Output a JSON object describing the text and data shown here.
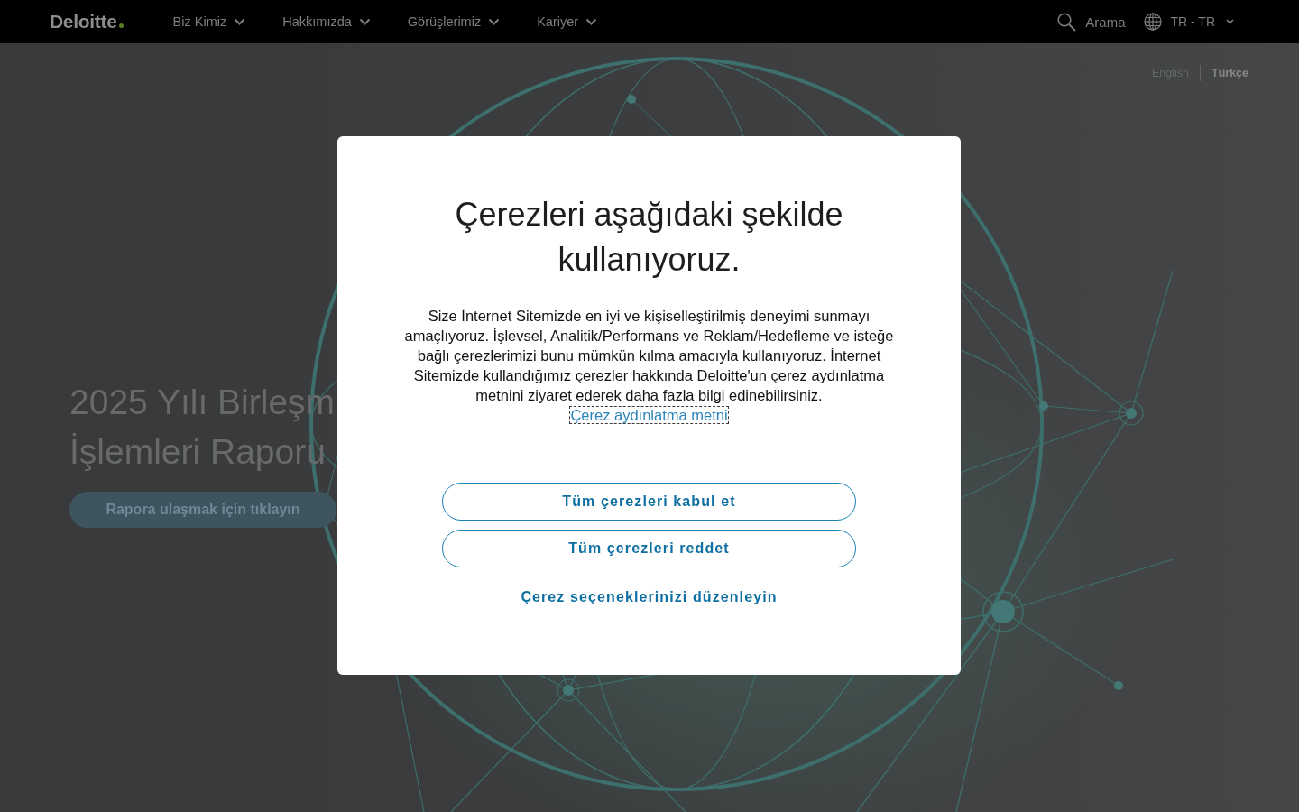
{
  "header": {
    "logo": "Deloitte",
    "nav": [
      {
        "label": "Biz Kimiz"
      },
      {
        "label": "Hakkımızda"
      },
      {
        "label": "Görüşlerimiz"
      },
      {
        "label": "Kariyer"
      }
    ],
    "search": {
      "label": "Arama"
    },
    "locale": {
      "label": "TR - TR"
    }
  },
  "hero": {
    "languages": [
      {
        "label": "English",
        "selected": false
      },
      {
        "label": "Türkçe",
        "selected": true
      }
    ],
    "title_lines": [
      "2025 Yılı Birleşm",
      "İşlemleri Raporu"
    ],
    "button": "Rapora ulaşmak için tıklayın"
  },
  "cookie_dialog": {
    "title": "Çerezleri aşağıdaki şekilde kullanıyoruz.",
    "body": "Size İnternet Sitemizde en iyi ve kişiselleştirilmiş deneyimi sunmayı amaçlıyoruz. İşlevsel, Analitik/Performans ve Reklam/Hedefleme ve isteğe bağlı çerezlerimizi bunu mümkün kılma amacıyla kullanıyoruz. İnternet Sitemizde kullandığımız çerezler hakkında Deloitte'un çerez aydınlatma metnini ziyaret ederek daha fazla bilgi edinebilirsiniz.",
    "policy_link": {
      "label": "Çerez aydınlatma metni",
      "focused": true
    },
    "buttons": [
      "Tüm çerezleri kabul et",
      "Tüm çerezleri reddet"
    ],
    "settings_link": "Çerez seçeneklerinizi düzenleyin"
  }
}
